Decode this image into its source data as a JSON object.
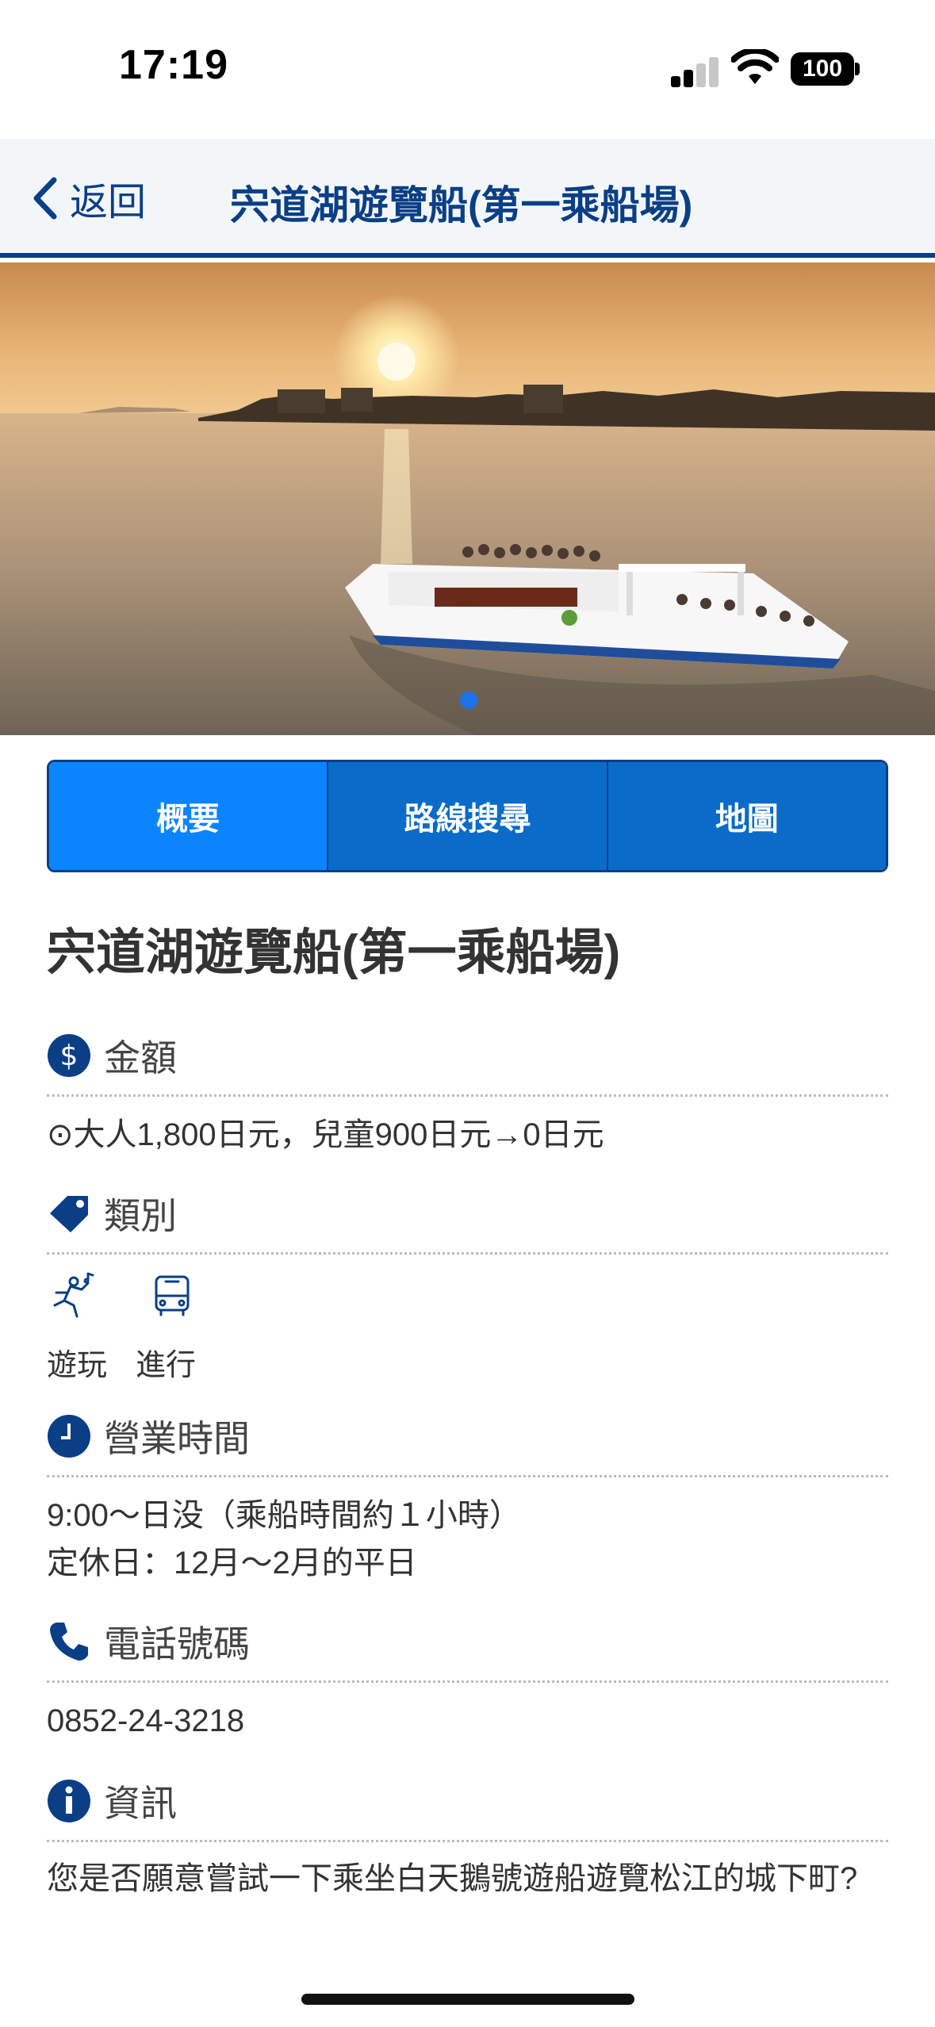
{
  "status_bar": {
    "time": "17:19",
    "battery": "100"
  },
  "header": {
    "back_label": "返回",
    "title": "宍道湖遊覽船(第一乘船場)"
  },
  "tabs": [
    {
      "label": "概要",
      "active": true
    },
    {
      "label": "路線搜尋",
      "active": false
    },
    {
      "label": "地圖",
      "active": false
    }
  ],
  "main": {
    "title": "宍道湖遊覽船(第一乘船場)",
    "price": {
      "label": "金額",
      "text": "⊙大人1,800日元，兒童900日元→0日元"
    },
    "category": {
      "label": "類別",
      "items": [
        {
          "icon": "play-icon",
          "label": "遊玩"
        },
        {
          "icon": "bus-icon",
          "label": "進行"
        }
      ]
    },
    "hours": {
      "label": "營業時間",
      "line1": "9:00〜日没（乘船時間約１小時）",
      "line2": "定休日：12月〜2月的平日"
    },
    "phone": {
      "label": "電話號碼",
      "value": "0852-24-3218"
    },
    "info": {
      "label": "資訊",
      "text": "您是否願意嘗試一下乘坐白天鵝號遊船遊覽松江的城下町?"
    }
  },
  "colors": {
    "brand": "#0a3f86",
    "tab_active": "#0a84ff",
    "tab": "#0a6bc9"
  }
}
